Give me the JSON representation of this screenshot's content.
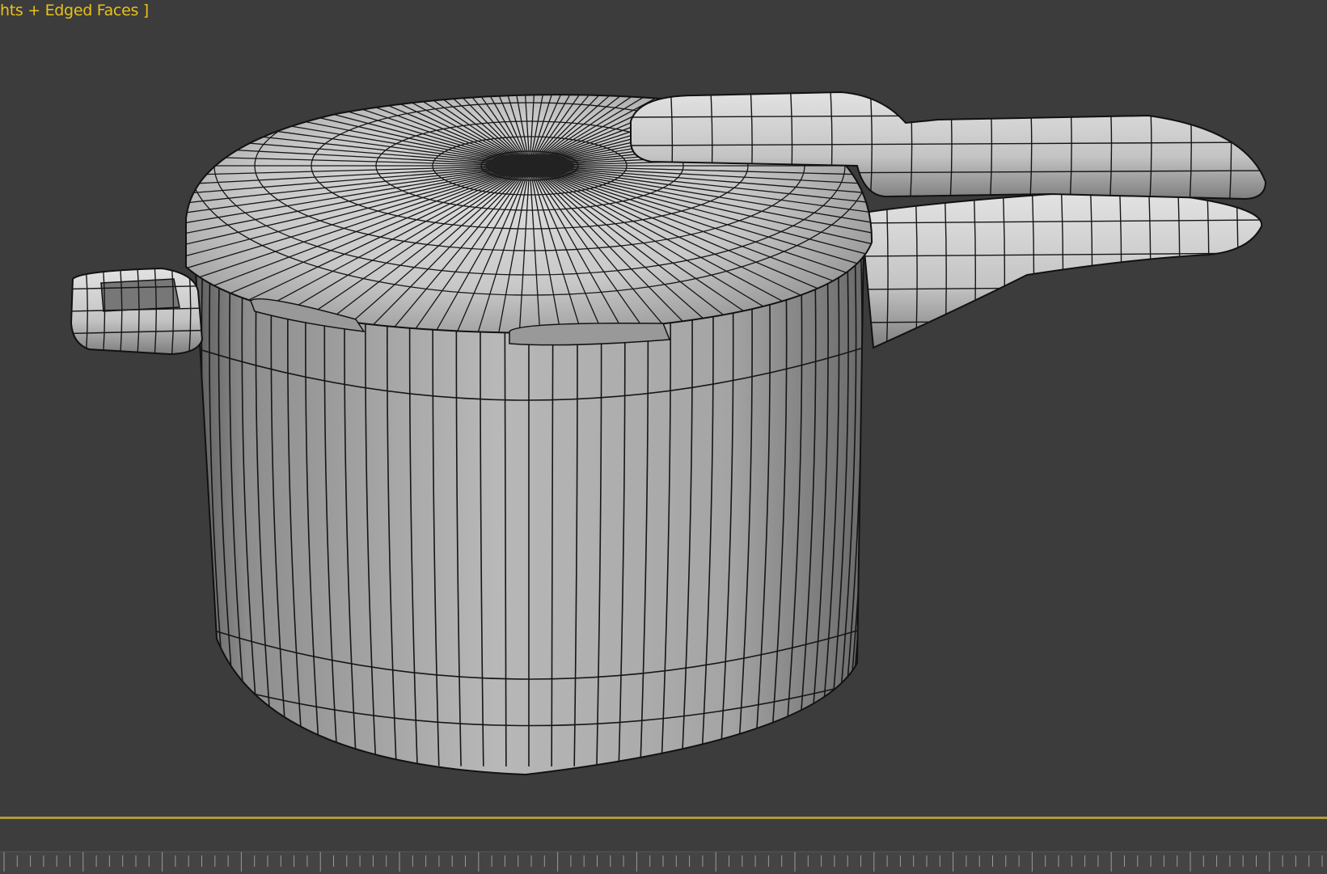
{
  "viewport": {
    "label": "hts + Edged Faces ]",
    "label_color": "#e8c21a",
    "background": "#3c3c3c"
  },
  "model": {
    "object": "pressure-cooker",
    "render_mode": "smooth-shaded-with-edged-faces",
    "mesh_color": "#a9a9a9",
    "edge_color": "#111111"
  },
  "timeline": {
    "border_color": "#b39a3a"
  }
}
